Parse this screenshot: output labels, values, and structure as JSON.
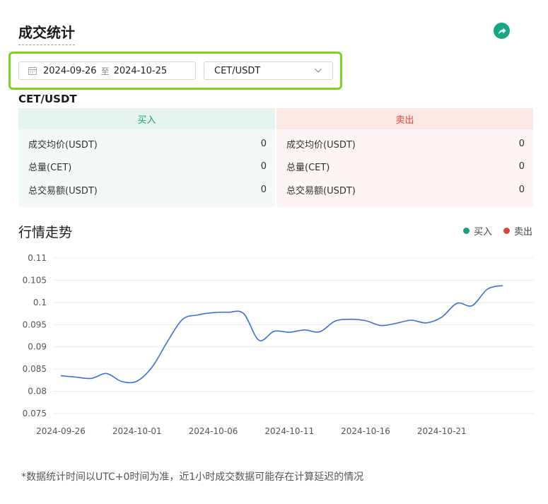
{
  "header": {
    "title": "成交统计",
    "share_icon": "share-arrow-icon",
    "accent": "#17a685"
  },
  "filters": {
    "start_date": "2024-09-26",
    "range_separator": "至",
    "end_date": "2024-10-25",
    "pair": "CET/USDT"
  },
  "pair_heading": "CET/USDT",
  "buy_panel": {
    "title": "买入",
    "color": "#15a07f",
    "rows": [
      {
        "label": "成交均价(USDT)",
        "value": "0"
      },
      {
        "label": "总量(CET)",
        "value": "0"
      },
      {
        "label": "总交易额(USDT)",
        "value": "0"
      }
    ]
  },
  "sell_panel": {
    "title": "卖出",
    "color": "#d4483b",
    "rows": [
      {
        "label": "成交均价(USDT)",
        "value": "0"
      },
      {
        "label": "总量(CET)",
        "value": "0"
      },
      {
        "label": "总交易额(USDT)",
        "value": "0"
      }
    ]
  },
  "trend": {
    "title": "行情走势",
    "legend": [
      {
        "label": "买入",
        "color": "#15a07f"
      },
      {
        "label": "卖出",
        "color": "#d4483b"
      }
    ]
  },
  "chart_data": {
    "type": "line",
    "ylim": [
      0.075,
      0.11
    ],
    "yticks": [
      "0.11",
      "0.105",
      "0.1",
      "0.095",
      "0.09",
      "0.085",
      "0.08",
      "0.075"
    ],
    "xticks": [
      "2024-09-26",
      "2024-10-01",
      "2024-10-06",
      "2024-10-11",
      "2024-10-16",
      "2024-10-21"
    ],
    "grid": true,
    "line_color": "#3b6fd6",
    "x": [
      "2024-09-26",
      "2024-09-27",
      "2024-09-28",
      "2024-09-29",
      "2024-09-30",
      "2024-10-01",
      "2024-10-02",
      "2024-10-03",
      "2024-10-04",
      "2024-10-05",
      "2024-10-06",
      "2024-10-07",
      "2024-10-08",
      "2024-10-09",
      "2024-10-10",
      "2024-10-11",
      "2024-10-12",
      "2024-10-13",
      "2024-10-14",
      "2024-10-15",
      "2024-10-16",
      "2024-10-17",
      "2024-10-18",
      "2024-10-19",
      "2024-10-20",
      "2024-10-21",
      "2024-10-22",
      "2024-10-23",
      "2024-10-24",
      "2024-10-25"
    ],
    "series": [
      {
        "values": [
          0.0835,
          0.0832,
          0.0829,
          0.084,
          0.0822,
          0.0823,
          0.0855,
          0.0912,
          0.0962,
          0.0972,
          0.0977,
          0.0978,
          0.0975,
          0.0915,
          0.0935,
          0.0933,
          0.0938,
          0.0934,
          0.0958,
          0.0962,
          0.0959,
          0.0948,
          0.0953,
          0.096,
          0.0954,
          0.0967,
          0.0998,
          0.0993,
          0.103,
          0.1038
        ]
      }
    ]
  },
  "footnote": "*数据统计时间以UTC+0时间为准，近1小时成交数据可能存在计算延迟的情况"
}
